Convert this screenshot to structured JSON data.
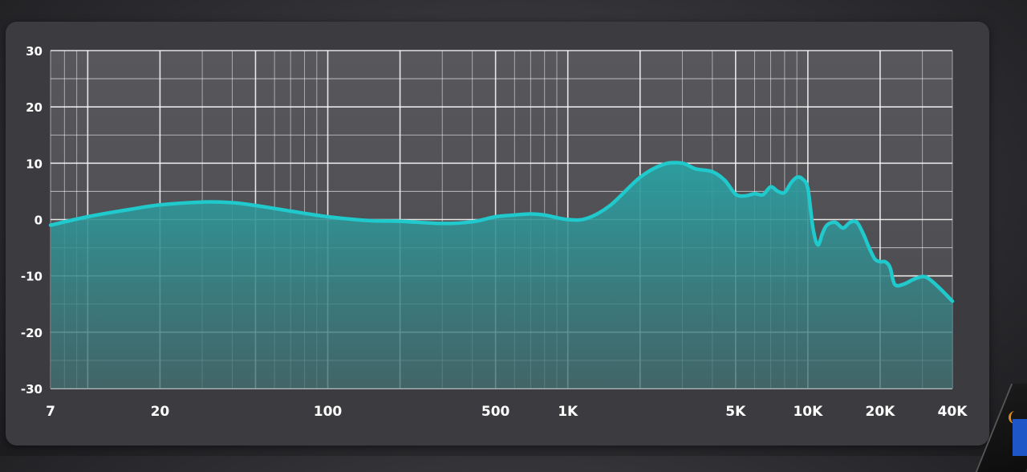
{
  "chart_data": {
    "type": "area",
    "title": "",
    "xlabel": "",
    "ylabel": "",
    "x_scale": "log",
    "xlim": [
      7,
      40000
    ],
    "ylim": [
      -30,
      30
    ],
    "grid": true,
    "line_color": "#1fc9cc",
    "fill_color": "#2aa0a2",
    "background_color": "#3c3c40",
    "grid_color": "#ffffff",
    "y_ticks": [
      30,
      20,
      10,
      0,
      -10,
      -20,
      -30
    ],
    "y_tick_labels": [
      "30",
      "20",
      "10",
      "0",
      "-10",
      "-20",
      "-30"
    ],
    "x_ticks": [
      7,
      20,
      100,
      500,
      1000,
      5000,
      10000,
      20000,
      40000
    ],
    "x_tick_labels": [
      "7",
      "20",
      "100",
      "500",
      "1K",
      "5K",
      "10K",
      "20K",
      "40K"
    ],
    "series": [
      {
        "x": [
          7,
          10,
          15,
          20,
          30,
          40,
          50,
          70,
          100,
          150,
          200,
          300,
          400,
          500,
          600,
          700,
          800,
          1000,
          1200,
          1500,
          2000,
          2500,
          3000,
          3400,
          4000,
          4500,
          5000,
          5500,
          6000,
          6500,
          7000,
          7500,
          8000,
          8500,
          9000,
          9500,
          10000,
          10500,
          11000,
          11500,
          12000,
          13000,
          14000,
          15000,
          16000,
          17000,
          18000,
          19000,
          20000,
          21000,
          22000,
          23000,
          25000,
          28000,
          31000,
          35000,
          40000
        ],
        "y": [
          -1,
          0.5,
          1.8,
          2.6,
          3.1,
          3.0,
          2.5,
          1.5,
          0.5,
          -0.2,
          -0.3,
          -0.7,
          -0.4,
          0.5,
          0.8,
          1.0,
          0.8,
          0.0,
          0.2,
          2.5,
          7.5,
          9.8,
          10.0,
          9.0,
          8.5,
          7.0,
          4.5,
          4.2,
          4.6,
          4.4,
          5.8,
          5.0,
          4.8,
          6.5,
          7.5,
          7.2,
          5.5,
          -1.5,
          -4.5,
          -2.5,
          -1.0,
          -0.5,
          -1.5,
          -0.5,
          -0.5,
          -2.5,
          -5.0,
          -7.0,
          -7.5,
          -7.5,
          -8.5,
          -11.5,
          -11.5,
          -10.5,
          -10.2,
          -12.0,
          -14.5
        ]
      }
    ]
  }
}
